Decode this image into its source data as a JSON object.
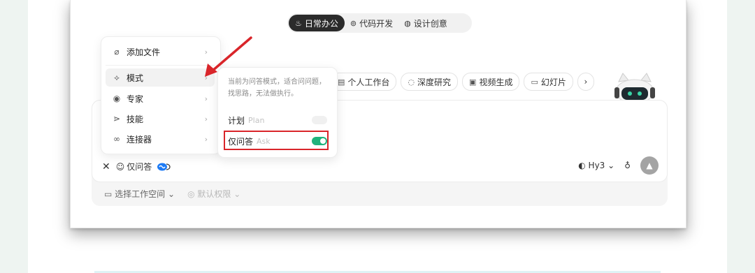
{
  "tabs": [
    {
      "label": "日常办公",
      "icon": "mug-icon",
      "active": true
    },
    {
      "label": "代码开发",
      "icon": "code-icon",
      "active": false
    },
    {
      "label": "设计创意",
      "icon": "palette-icon",
      "active": false
    }
  ],
  "chips": [
    {
      "label": "个人工作台",
      "icon": "workspace-icon"
    },
    {
      "label": "深度研究",
      "icon": "search-icon"
    },
    {
      "label": "视频生成",
      "icon": "video-icon"
    },
    {
      "label": "幻灯片",
      "icon": "slides-icon"
    }
  ],
  "chips_more": "›",
  "menu": {
    "items": [
      {
        "label": "添加文件",
        "icon": "paperclip-icon",
        "chevron": "›"
      },
      {
        "label": "模式",
        "icon": "mode-icon",
        "chevron": "›"
      },
      {
        "label": "专家",
        "icon": "expert-icon",
        "chevron": "›"
      },
      {
        "label": "技能",
        "icon": "skill-icon",
        "chevron": "›"
      },
      {
        "label": "连接器",
        "icon": "link-icon",
        "chevron": "›"
      }
    ]
  },
  "submenu": {
    "description": "当前为问答模式，适合问问题，找思路，无法做执行。",
    "options": [
      {
        "label": "计划",
        "en": "Plan",
        "on": false
      },
      {
        "label": "仅问答",
        "en": "Ask",
        "on": true
      }
    ]
  },
  "composer": {
    "close": "✕",
    "mode_label": "仅问答",
    "model": "Hy3",
    "workspace": "选择工作空间",
    "permission": "默认权限"
  },
  "colors": {
    "toggle_on": "#1fb37c",
    "highlight_box": "#d9252a",
    "arrow": "#d9252a",
    "send_button": "#a4a4a4"
  }
}
